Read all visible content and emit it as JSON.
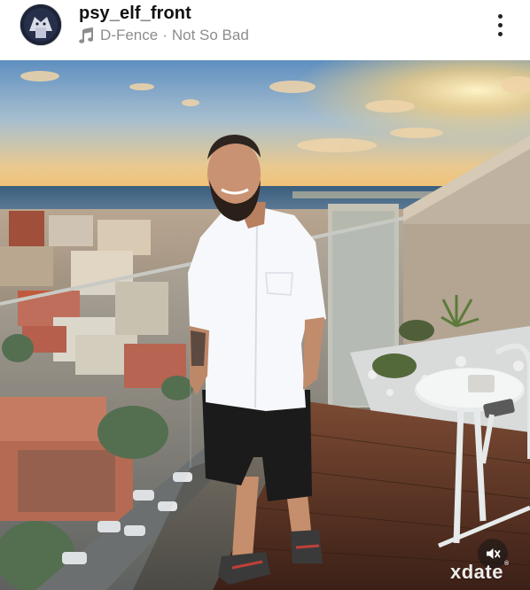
{
  "post": {
    "username": "psy_elf_front",
    "music": {
      "icon": "music-note-icon",
      "artist": "D-Fence",
      "separator": "·",
      "track": "Not So Bad"
    },
    "more_icon": "more-vertical-icon"
  },
  "media": {
    "type": "photo",
    "mute_icon": "speaker-muted-icon",
    "watermark": "xdate",
    "watermark_mark": "®"
  },
  "colors": {
    "text": "#111111",
    "muted": "#8d8d8d",
    "sky_top": "#5f8fc0",
    "sunset": "#f6c46d",
    "deck": "#5a3526"
  }
}
